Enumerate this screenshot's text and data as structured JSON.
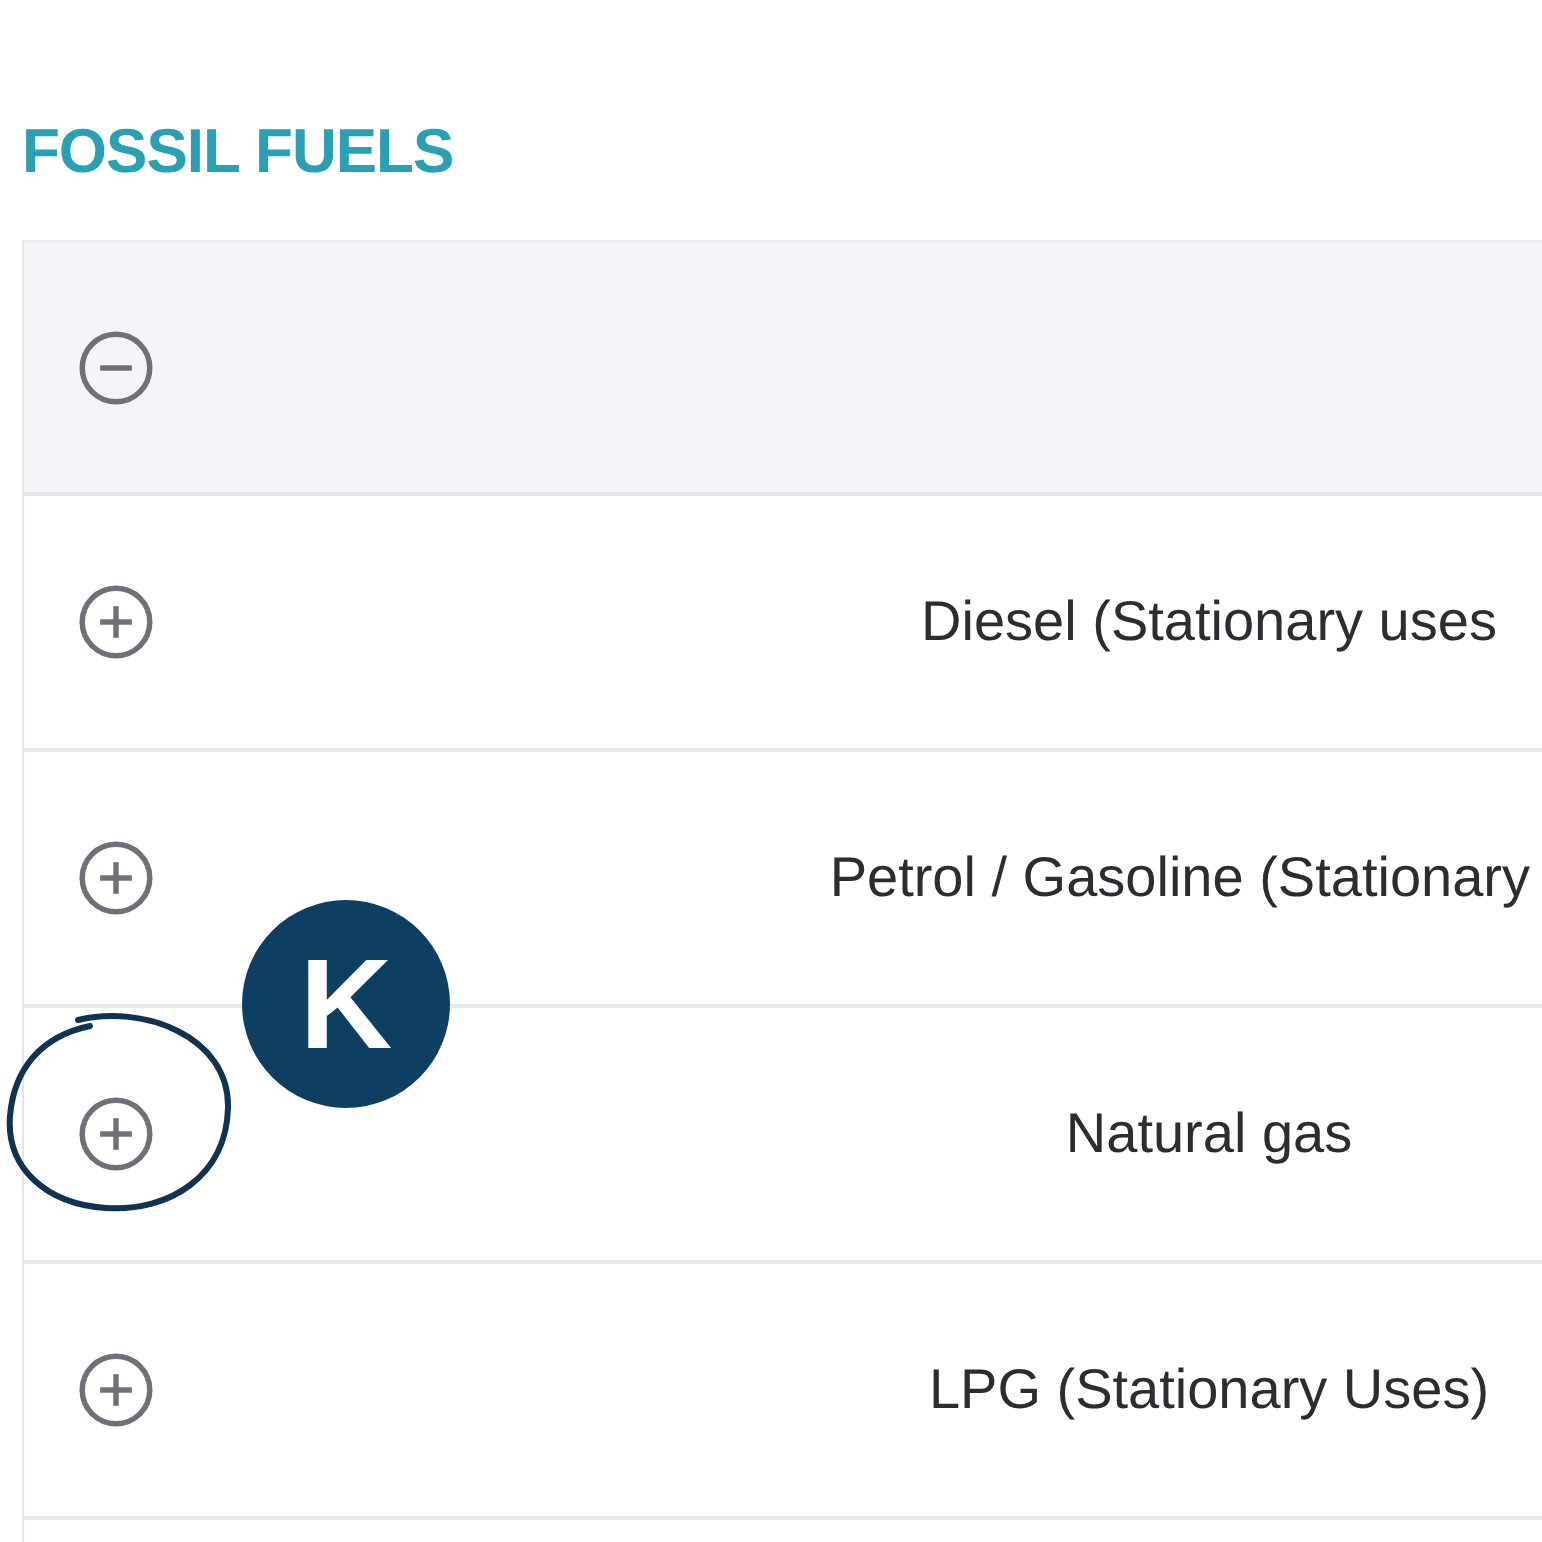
{
  "title": "FOSSIL FUELS",
  "header": {
    "expanded": true
  },
  "rows": [
    {
      "label": "Diesel (Stationary uses",
      "expanded": false
    },
    {
      "label": "Petrol / Gasoline (Stationary",
      "expanded": false
    },
    {
      "label": "Natural gas",
      "expanded": false
    },
    {
      "label": "LPG (Stationary Uses)",
      "expanded": false
    }
  ],
  "annotation": {
    "badge": "K"
  }
}
